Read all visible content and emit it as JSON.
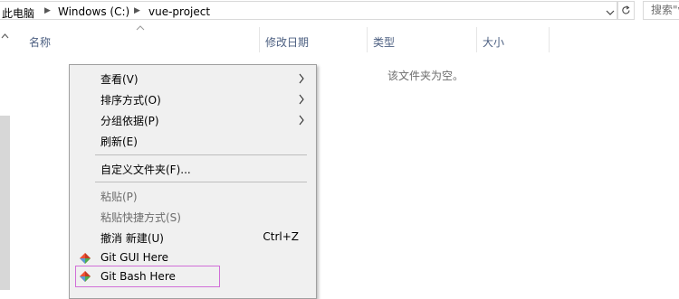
{
  "address_bar": {
    "crumbs": [
      "此电脑",
      "Windows (C:)",
      "vue-project"
    ],
    "search_placeholder": "搜索\"vue-project\""
  },
  "columns": [
    "名称",
    "修改日期",
    "类型",
    "大小"
  ],
  "empty_message": "该文件夹为空。",
  "context_menu": {
    "items": [
      {
        "label": "查看(V)",
        "submenu": true,
        "enabled": true
      },
      {
        "label": "排序方式(O)",
        "submenu": true,
        "enabled": true
      },
      {
        "label": "分组依据(P)",
        "submenu": true,
        "enabled": true
      },
      {
        "label": "刷新(E)",
        "enabled": true
      },
      {
        "label": "自定义文件夹(F)...",
        "enabled": true
      },
      {
        "label": "粘贴(P)",
        "enabled": false
      },
      {
        "label": "粘贴快捷方式(S)",
        "enabled": false
      },
      {
        "label": "撤消 新建(U)",
        "shortcut": "Ctrl+Z",
        "enabled": true
      },
      {
        "label": "Git GUI Here",
        "icon": "git-icon",
        "enabled": true
      },
      {
        "label": "Git Bash Here",
        "icon": "git-icon",
        "enabled": true,
        "highlighted": true
      }
    ]
  },
  "colors": {
    "header_text": "#4d6082",
    "menu_background": "#f0f0f0",
    "highlight_border": "#d16ed8",
    "disabled_text": "#6d6d6d"
  }
}
